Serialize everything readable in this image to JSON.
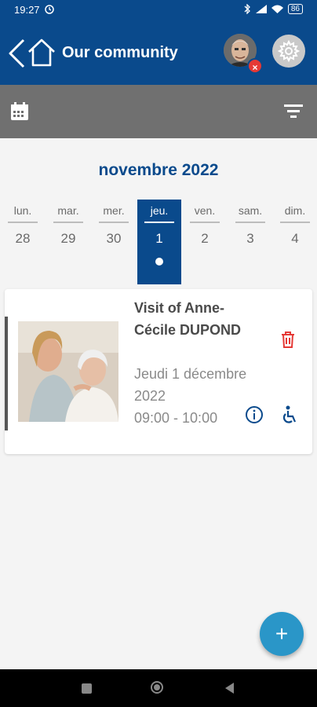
{
  "status_bar": {
    "time": "19:27",
    "battery": "86"
  },
  "app_bar": {
    "title": "Our community"
  },
  "calendar": {
    "month_label": "novembre 2022",
    "days": [
      {
        "name": "lun.",
        "date": "28"
      },
      {
        "name": "mar.",
        "date": "29"
      },
      {
        "name": "mer.",
        "date": "30"
      },
      {
        "name": "jeu.",
        "date": "1"
      },
      {
        "name": "ven.",
        "date": "2"
      },
      {
        "name": "sam.",
        "date": "3"
      },
      {
        "name": "dim.",
        "date": "4"
      }
    ],
    "selected_index": 3
  },
  "event": {
    "title": "Visit of Anne-Cécile DUPOND",
    "date_text": "Jeudi 1 décembre 2022",
    "time_range": "09:00 - 10:00"
  },
  "fab": {
    "label": "+"
  },
  "colors": {
    "primary": "#0a4a8c",
    "accent": "#2a96c8",
    "danger": "#e53935"
  }
}
